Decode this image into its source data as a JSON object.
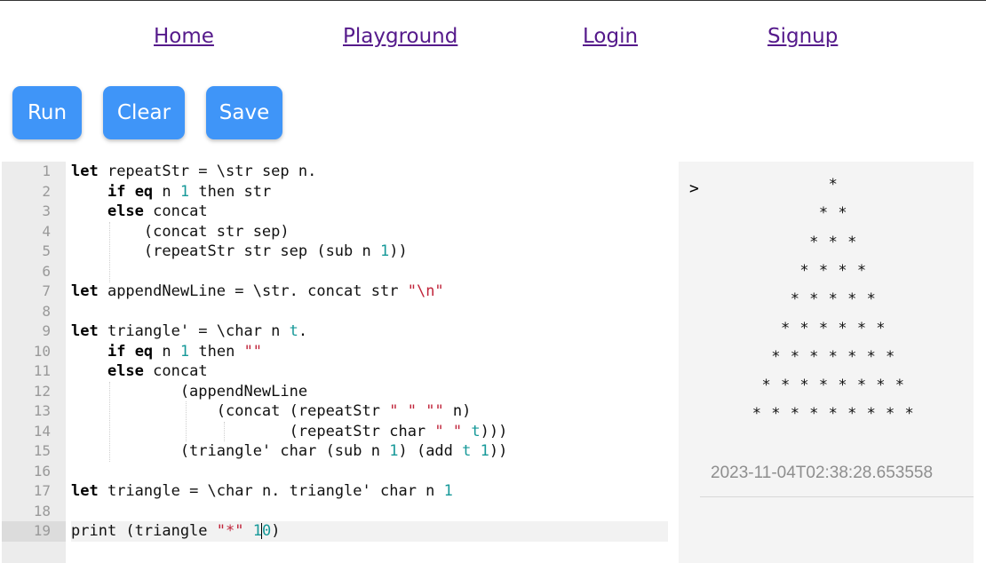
{
  "nav": {
    "home": "Home",
    "playground": "Playground",
    "login": "Login",
    "signup": "Signup"
  },
  "toolbar": {
    "run_label": "Run",
    "clear_label": "Clear",
    "save_label": "Save"
  },
  "editor": {
    "line_numbers": [
      "1",
      "2",
      "3",
      "4",
      "5",
      "6",
      "7",
      "8",
      "9",
      "10",
      "11",
      "12",
      "13",
      "14",
      "15",
      "16",
      "17",
      "18",
      "19"
    ],
    "active_line": 19,
    "code": [
      "let repeatStr = \\str sep n.",
      "    if eq n 1 then str",
      "    else concat",
      "        (concat str sep)",
      "        (repeatStr str sep (sub n 1))",
      "",
      "let appendNewLine = \\str. concat str \"\\n\"",
      "",
      "let triangle' = \\char n t.",
      "    if eq n 1 then \"\"",
      "    else concat",
      "            (appendNewLine",
      "                (concat (repeatStr \" \" \"\" n)",
      "                        (repeatStr char \" \" t)))",
      "            (triangle' char (sub n 1) (add t 1))",
      "",
      "let triangle = \\char n. triangle' char n 1",
      "",
      "print (triangle \"*\" 10)"
    ]
  },
  "output": {
    "prompt": ">",
    "lines": [
      "*",
      "* *",
      "* * *",
      "* * * *",
      "* * * * *",
      "* * * * * *",
      "* * * * * * *",
      "* * * * * * * *",
      "* * * * * * * * *"
    ],
    "timestamp": "2023-11-04T02:38:28.653558"
  },
  "colors": {
    "button": "#3f95f8",
    "link": "#551a8b",
    "number": "#179999",
    "string": "#c0243a"
  }
}
